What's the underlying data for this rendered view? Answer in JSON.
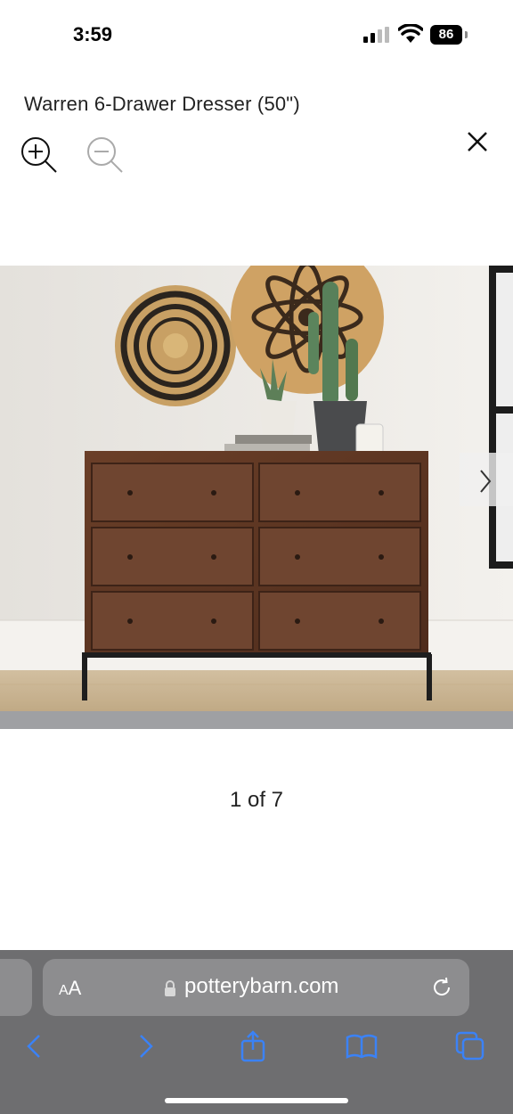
{
  "status_bar": {
    "time": "3:59",
    "battery": "86"
  },
  "viewer": {
    "title": "Warren 6-Drawer Dresser (50\")",
    "counter": "1 of 7"
  },
  "browser": {
    "text_size_label_small": "A",
    "text_size_label_large": "A",
    "url": "potterybarn.com"
  },
  "colors": {
    "toolbar_bg": "#6e6e70",
    "urlbar_bg": "#8d8d8f",
    "accent": "#3b82f6"
  },
  "icons": [
    "zoom-in-icon",
    "zoom-out-icon",
    "close-icon",
    "chevron-right-icon",
    "lock-icon",
    "reload-icon",
    "back-icon",
    "forward-icon",
    "share-icon",
    "bookmarks-icon",
    "tabs-icon"
  ]
}
